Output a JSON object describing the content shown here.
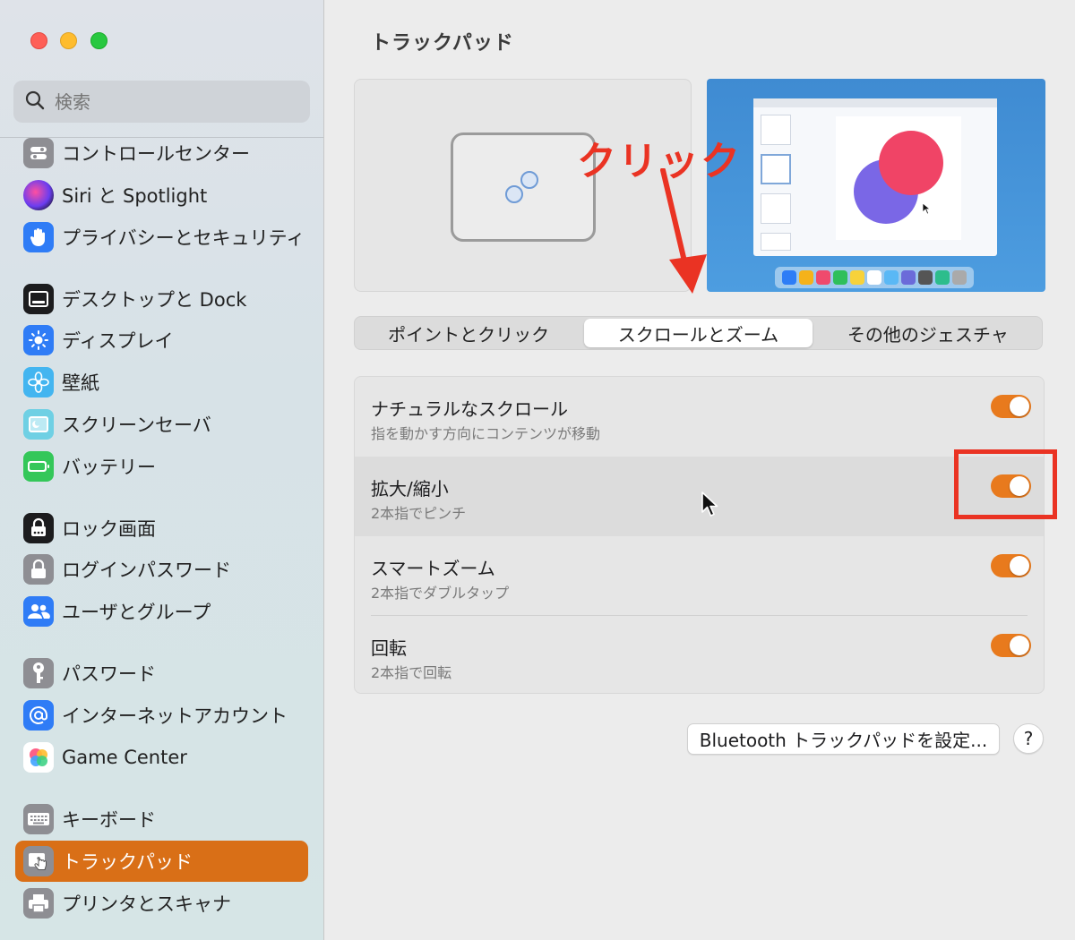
{
  "window": {
    "title": "トラックパッド"
  },
  "search": {
    "placeholder": "検索"
  },
  "sidebar": {
    "items": [
      {
        "label": "コントロールセンター",
        "icon": "control-center-icon"
      },
      {
        "label": "Siri と Spotlight",
        "icon": "siri-icon"
      },
      {
        "label": "プライバシーとセキュリティ",
        "icon": "privacy-hand-icon"
      },
      {
        "label": "デスクトップと Dock",
        "icon": "desktop-dock-icon"
      },
      {
        "label": "ディスプレイ",
        "icon": "display-sun-icon"
      },
      {
        "label": "壁紙",
        "icon": "wallpaper-flower-icon"
      },
      {
        "label": "スクリーンセーバ",
        "icon": "screensaver-icon"
      },
      {
        "label": "バッテリー",
        "icon": "battery-icon"
      },
      {
        "label": "ロック画面",
        "icon": "lock-screen-icon"
      },
      {
        "label": "ログインパスワード",
        "icon": "login-lock-icon"
      },
      {
        "label": "ユーザとグループ",
        "icon": "users-icon"
      },
      {
        "label": "パスワード",
        "icon": "key-icon"
      },
      {
        "label": "インターネットアカウント",
        "icon": "at-sign-icon"
      },
      {
        "label": "Game Center",
        "icon": "game-center-icon"
      },
      {
        "label": "キーボード",
        "icon": "keyboard-icon"
      },
      {
        "label": "トラックパッド",
        "icon": "trackpad-icon",
        "selected": true
      },
      {
        "label": "プリンタとスキャナ",
        "icon": "printer-icon"
      }
    ]
  },
  "annotation": {
    "click_label": "クリック"
  },
  "tabs": [
    {
      "label": "ポイントとクリック",
      "selected": false
    },
    {
      "label": "スクロールとズーム",
      "selected": true
    },
    {
      "label": "その他のジェスチャ",
      "selected": false
    }
  ],
  "settings": [
    {
      "title": "ナチュラルなスクロール",
      "subtitle": "指を動かす方向にコンテンツが移動",
      "enabled": true
    },
    {
      "title": "拡大/縮小",
      "subtitle": "2本指でピンチ",
      "enabled": true
    },
    {
      "title": "スマートズーム",
      "subtitle": "2本指でダブルタップ",
      "enabled": true
    },
    {
      "title": "回転",
      "subtitle": "2本指で回転",
      "enabled": true
    }
  ],
  "buttons": {
    "bluetooth": "Bluetooth トラックパッドを設定...",
    "help": "?"
  },
  "colors": {
    "accent": "#e87a1d",
    "selection": "#d96f17",
    "annotation_red": "#ea3323"
  }
}
